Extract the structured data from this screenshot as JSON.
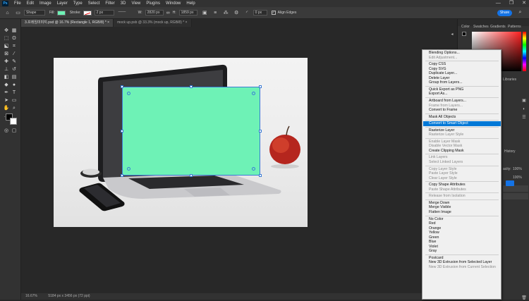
{
  "menubar": {
    "logo": "Ps",
    "items": [
      "File",
      "Edit",
      "Image",
      "Layer",
      "Type",
      "Select",
      "Filter",
      "3D",
      "View",
      "Plugins",
      "Window",
      "Help"
    ],
    "window_controls": [
      "—",
      "❐",
      "✕"
    ]
  },
  "optionsbar": {
    "mode": "Shape",
    "fill_label": "Fill:",
    "stroke_label": "Stroke:",
    "stroke_width": "2 px",
    "w_label": "W:",
    "w_value": "2820 px",
    "h_label": "H:",
    "h_value": "1859 px",
    "radius": "0 px",
    "align_edges": "Align Edges",
    "share": "Share",
    "fill_color": "#6ef2b6"
  },
  "tabs": [
    {
      "label": "3.프레임미미지.psd @ 16.7% (Rectangle 1, RGB/8) *",
      "active": true
    },
    {
      "label": "mock up.psb @ 33.3% (mock up, RGB/8) *",
      "active": false
    }
  ],
  "statusbar": {
    "zoom": "16.67%",
    "info": "5184 px x 3456 px (72 ppi)"
  },
  "document": {
    "rect_color": "#6ef2b6"
  },
  "right_panel": {
    "tabs": [
      "Color",
      "Swatches",
      "Gradients",
      "Patterns"
    ],
    "partial_labels": {
      "libraries": "Libraries",
      "history": "History",
      "opacity_label": "acity:",
      "opacity_value": "100%",
      "fill_value": "100%"
    }
  },
  "context_menu": {
    "items": [
      {
        "label": "Blending Options...",
        "disabled": false
      },
      {
        "label": "Edit Adjustment...",
        "disabled": true
      },
      {
        "sep": true
      },
      {
        "label": "Copy CSS",
        "disabled": false
      },
      {
        "label": "Copy SVG",
        "disabled": false
      },
      {
        "label": "Duplicate Layer...",
        "disabled": false
      },
      {
        "label": "Delete Layer",
        "disabled": false
      },
      {
        "label": "Group from Layers...",
        "disabled": false
      },
      {
        "sep": true
      },
      {
        "label": "Quick Export as PNG",
        "disabled": false
      },
      {
        "label": "Export As...",
        "disabled": false
      },
      {
        "sep": true
      },
      {
        "label": "Artboard from Layers...",
        "disabled": false
      },
      {
        "label": "Frame from Layers...",
        "disabled": true
      },
      {
        "label": "Convert to Frame",
        "disabled": false
      },
      {
        "sep": true
      },
      {
        "label": "Mask All Objects",
        "disabled": false
      },
      {
        "sep": true
      },
      {
        "label": "Convert to Smart Object",
        "disabled": false,
        "highlight": true
      },
      {
        "sep": true
      },
      {
        "label": "Rasterize Layer",
        "disabled": false
      },
      {
        "label": "Rasterize Layer Style",
        "disabled": true
      },
      {
        "sep": true
      },
      {
        "label": "Enable Layer Mask",
        "disabled": true
      },
      {
        "label": "Disable Vector Mask",
        "disabled": true
      },
      {
        "label": "Create Clipping Mask",
        "disabled": false
      },
      {
        "sep": true
      },
      {
        "label": "Link Layers",
        "disabled": true
      },
      {
        "label": "Select Linked Layers",
        "disabled": true
      },
      {
        "sep": true
      },
      {
        "label": "Copy Layer Style",
        "disabled": true
      },
      {
        "label": "Paste Layer Style",
        "disabled": true
      },
      {
        "label": "Clear Layer Style",
        "disabled": true
      },
      {
        "sep": true
      },
      {
        "label": "Copy Shape Attributes",
        "disabled": false
      },
      {
        "label": "Paste Shape Attributes",
        "disabled": true
      },
      {
        "sep": true
      },
      {
        "label": "Release from Isolation",
        "disabled": true
      },
      {
        "sep": true
      },
      {
        "label": "Merge Down",
        "disabled": false
      },
      {
        "label": "Merge Visible",
        "disabled": false
      },
      {
        "label": "Flatten Image",
        "disabled": false
      },
      {
        "sep": true
      },
      {
        "label": "No Color",
        "disabled": false
      },
      {
        "label": "Red",
        "disabled": false
      },
      {
        "label": "Orange",
        "disabled": false
      },
      {
        "label": "Yellow",
        "disabled": false
      },
      {
        "label": "Green",
        "disabled": false
      },
      {
        "label": "Blue",
        "disabled": false
      },
      {
        "label": "Violet",
        "disabled": false
      },
      {
        "label": "Gray",
        "disabled": false
      },
      {
        "sep": true
      },
      {
        "label": "Postcard",
        "disabled": false
      },
      {
        "label": "New 3D Extrusion from Selected Layer",
        "disabled": false
      },
      {
        "label": "New 3D Extrusion from Current Selection",
        "disabled": true
      }
    ]
  }
}
